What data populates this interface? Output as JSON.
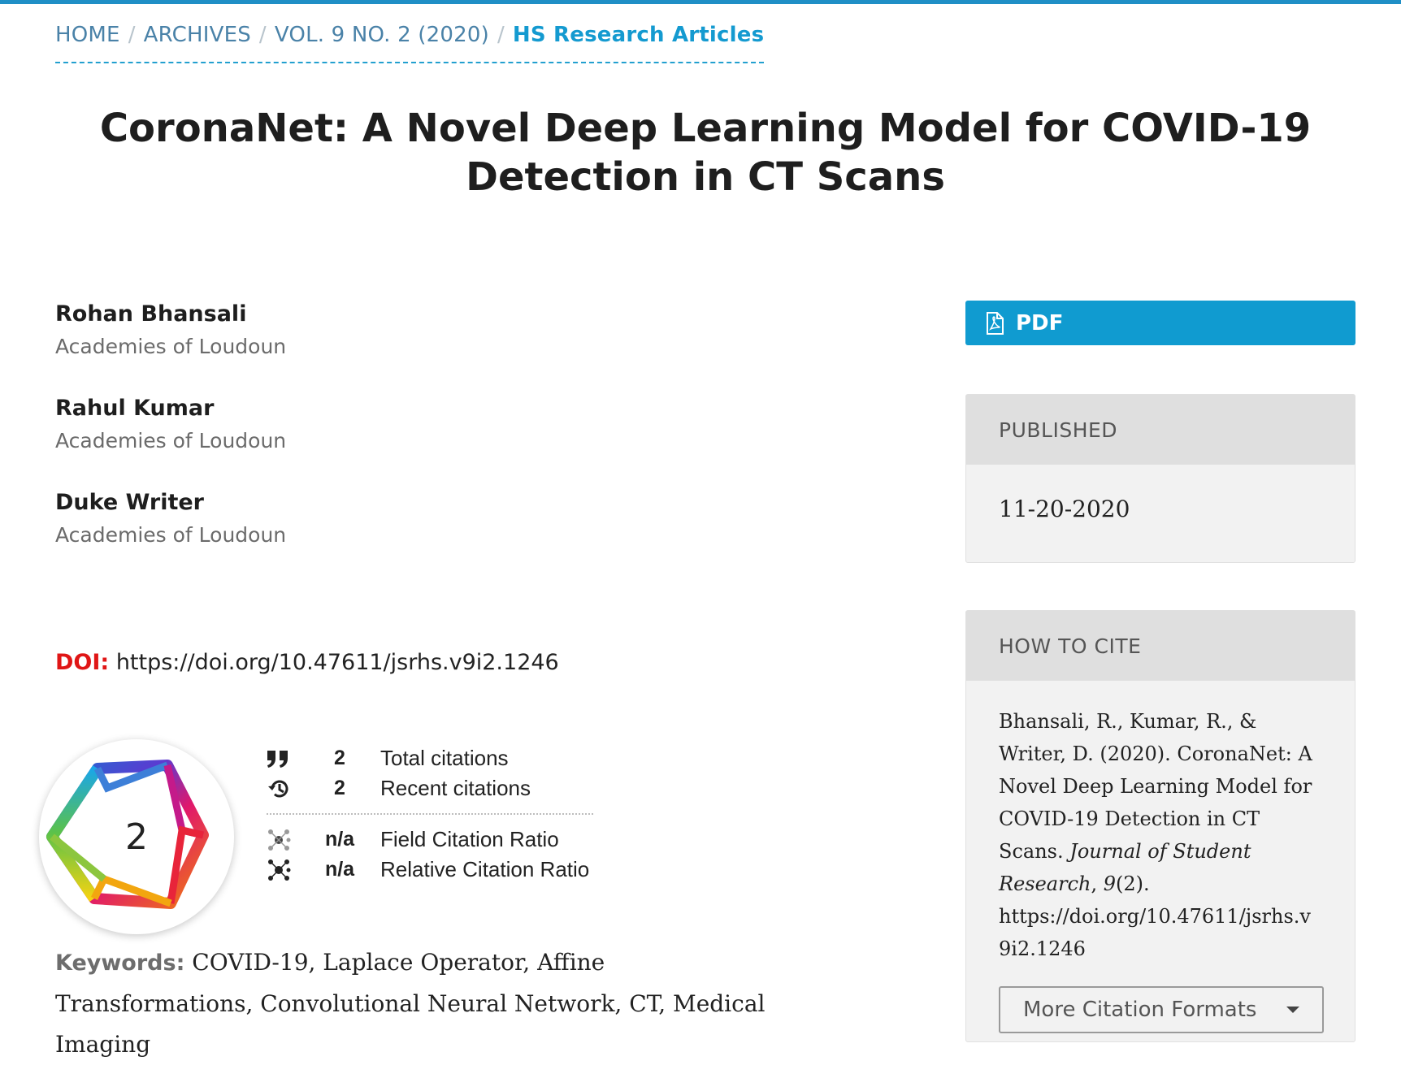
{
  "breadcrumb": {
    "home": "HOME",
    "archives": "ARCHIVES",
    "issue": "VOL. 9 NO. 2 (2020)",
    "current": "HS Research Articles",
    "separator": "/"
  },
  "article": {
    "title": "CoronaNet: A Novel Deep Learning Model for COVID-19 Detection in CT Scans",
    "authors": [
      {
        "name": "Rohan Bhansali",
        "affiliation": "Academies of Loudoun"
      },
      {
        "name": "Rahul Kumar",
        "affiliation": "Academies of Loudoun"
      },
      {
        "name": "Duke Writer",
        "affiliation": "Academies of Loudoun"
      }
    ],
    "doi_label": "DOI:",
    "doi": "https://doi.org/10.47611/jsrhs.v9i2.1246",
    "keywords_label": "Keywords:",
    "keywords": "COVID-19, Laplace Operator, Affine Transformations, Convolutional Neural Network, CT, Medical Imaging"
  },
  "metrics": {
    "badge_value": "2",
    "total_citations": {
      "value": "2",
      "label": "Total citations"
    },
    "recent_citations": {
      "value": "2",
      "label": "Recent citations"
    },
    "field_citation_ratio": {
      "value": "n/a",
      "label": "Field Citation Ratio"
    },
    "relative_citation_ratio": {
      "value": "n/a",
      "label": "Relative Citation Ratio"
    }
  },
  "sidebar": {
    "pdf_label": "PDF",
    "published": {
      "heading": "PUBLISHED",
      "date": "11-20-2020"
    },
    "cite": {
      "heading": "HOW TO CITE",
      "authors": "Bhansali, R., Kumar, R., & Writer, D. (2020). CoronaNet: A Novel Deep Learning Model for COVID-19 Detection in CT Scans.",
      "journal": "Journal of Student Research",
      "volume": "9",
      "issue_rest": "(2).",
      "url": "https://doi.org/10.47611/jsrhs.v9i2.1246",
      "more_formats": "More Citation Formats"
    }
  },
  "colors": {
    "accent": "#109bd0",
    "doi_label": "#e01616",
    "breadcrumb_link": "#4a82a8"
  },
  "icons": [
    "pdf-icon",
    "quote-icon",
    "history-icon",
    "network-icon",
    "chevron-down-icon"
  ]
}
